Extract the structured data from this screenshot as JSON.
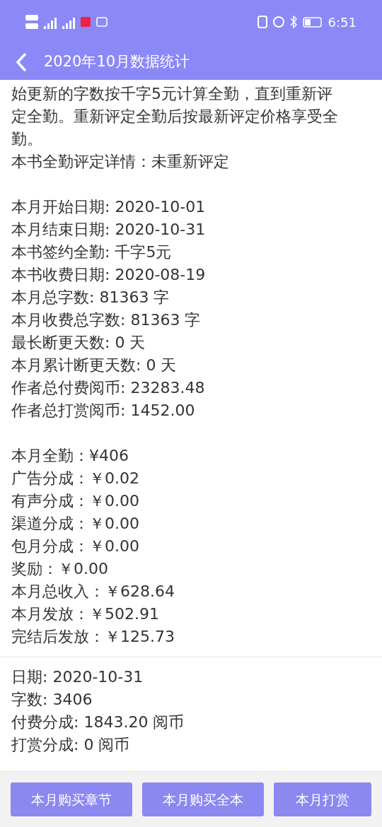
{
  "status_bar": {
    "time": "6:51"
  },
  "header": {
    "title": "2020年10月数据统计"
  },
  "intro": {
    "paragraph": "始更新的字数按千字5元计算全勤，直到重新评定全勤。重新评定全勤后按最新评定价格享受全勤。",
    "detail": "本书全勤评定详情：未重新评定"
  },
  "summary": [
    "本月开始日期: 2020-10-01",
    "本月结束日期: 2020-10-31",
    "本书签约全勤: 千字5元",
    "本书收费日期: 2020-08-19",
    "本月总字数: 81363 字",
    "本月收费总字数: 81363 字",
    "最长断更天数: 0 天",
    "本月累计断更天数: 0 天",
    "作者总付费阅币: 23283.48",
    "作者总打赏阅币: 1452.00"
  ],
  "income": [
    "本月全勤：¥406",
    "广告分成：￥0.02",
    "有声分成：￥0.00",
    "渠道分成：￥0.00",
    "包月分成：￥0.00",
    "奖励：￥0.00",
    "本月总收入：￥628.64",
    "本月发放：￥502.91",
    "完结后发放：￥125.73"
  ],
  "daily": [
    "日期: 2020-10-31",
    "字数: 3406",
    "付费分成: 1843.20 阅币",
    "打赏分成: 0 阅币"
  ],
  "buttons": [
    "本月购买章节",
    "本月购买全本",
    "本月打赏"
  ]
}
